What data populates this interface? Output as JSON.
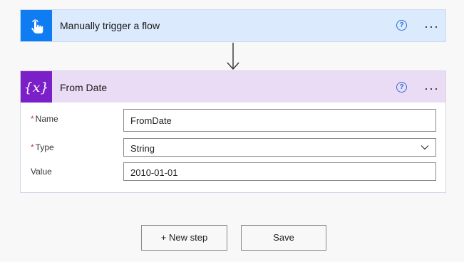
{
  "trigger": {
    "title": "Manually trigger a flow",
    "icon": "touch-hand-icon",
    "help_glyph": "?",
    "more_glyph": "···"
  },
  "variable": {
    "title": "From Date",
    "icon_text": "{x}",
    "help_glyph": "?",
    "more_glyph": "···",
    "fields": {
      "name": {
        "required_mark": "*",
        "label": "Name",
        "value": "FromDate"
      },
      "type": {
        "required_mark": "*",
        "label": "Type",
        "value": "String"
      },
      "value": {
        "label": "Value",
        "value": "2010-01-01"
      }
    }
  },
  "actions": {
    "new_step": "+ New step",
    "save": "Save"
  },
  "colors": {
    "trigger_accent": "#0f7cf2",
    "variable_accent": "#7b1fc8",
    "required": "#c73c3c"
  }
}
